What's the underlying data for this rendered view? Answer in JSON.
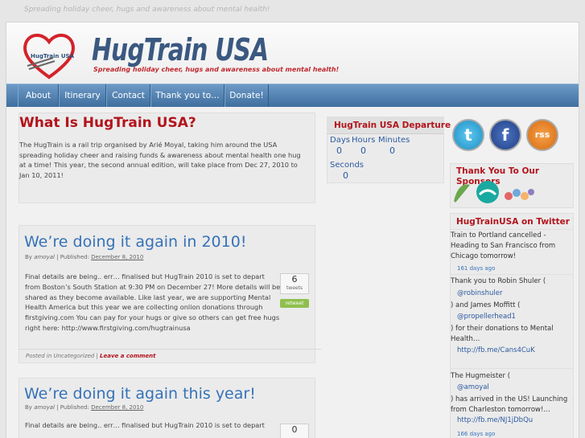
{
  "top_tagline": "Spreading holiday cheer, hugs and awareness about mental health!",
  "logo": {
    "title": "HugTrain USA",
    "subtitle": "Spreading holiday cheer, hugs and awareness about mental health!",
    "heart_text": "HugTrain USA"
  },
  "nav": [
    "About",
    "Itinerary",
    "Contact",
    "Thank you to…",
    "Donate!"
  ],
  "intro": {
    "heading": "What Is HugTrain USA?",
    "text": "The HugTrain is a rail trip organised by Arié Moyal, taking him around the USA spreading holiday cheer and raising funds & awareness about mental health one hug at a time! This year, the second annual edition, will take place from Dec 27, 2010 to Jan 10, 2011!"
  },
  "posts": [
    {
      "title": "We’re doing it again in 2010!",
      "meta_by": "By",
      "author": "amoyal",
      "meta_published": "| Published:",
      "date": "December 8, 2010",
      "body": "Final details are being.. err… finalised but HugTrain 2010 is set to depart from Boston’s South Station at 9:30 PM on December 27! More details will be shared as they become available. Like last year, we are supporting Mental Health America but this year we are collecting onlion donations through firstgiving.com You can pay for your hugs or give so others can get free hugs right here: http://www.firstgiving.com/hugtrainusa",
      "tweet_count": "6",
      "tweet_label": "tweets",
      "retweet": "retweet",
      "posted_in": "Posted in",
      "category": "Uncategorized",
      "comment_link": "Leave a comment"
    },
    {
      "title": "We’re doing it again this year!",
      "meta_by": "By",
      "author": "amoyal",
      "meta_published": "| Published:",
      "date": "December 8, 2010",
      "body": "Final details are being.. err… finalised but HugTrain 2010 is set to depart",
      "tweet_count": "0"
    }
  ],
  "countdown": {
    "title": "HugTrain USA Departure",
    "labels": [
      "Days",
      "Hours",
      "Minutes",
      "Seconds"
    ],
    "values": [
      "0",
      "0",
      "0",
      "0"
    ]
  },
  "social": {
    "twitter": "t",
    "facebook": "f",
    "rss": "rss"
  },
  "sponsors": {
    "title": "Thank You To Our Sponsors"
  },
  "twitter_feed": {
    "title": "HugTrainUSA on Twitter",
    "t1_text": "Train to Portland cancelled - Heading to San Francisco from Chicago tomorrow!",
    "t1_time": "161 days ago",
    "t2_text_a": "Thank you to Robin Shuler (",
    "t2_handle1": "@robinshuler",
    "t2_text_b": ") and James Moffitt (",
    "t2_handle2": "@propellerhead1",
    "t2_text_c": ") for their donations to Mental Health…",
    "t2_link": "http://fb.me/Cans4CuK",
    "t3_text_a": "The Hugmeister (",
    "t3_handle": "@amoyal",
    "t3_text_b": ") has arrived in the US! Launching from Charleston tomorrow!…",
    "t3_link": "http://fb.me/NJ1jDbQu",
    "t3_time": "166 days ago"
  },
  "colors": {
    "accent_red": "#b3141c",
    "nav_blue": "#4f80b3",
    "link_blue": "#3672b8"
  }
}
